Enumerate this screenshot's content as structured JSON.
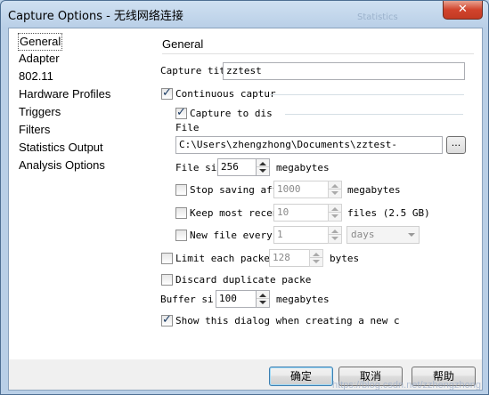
{
  "window": {
    "title": "Capture Options - 无线网络连接",
    "title_ghost": "Statistics",
    "close_glyph": "✕"
  },
  "sidebar": {
    "items": [
      {
        "label": "General",
        "selected": true
      },
      {
        "label": "Adapter"
      },
      {
        "label": "802.11"
      },
      {
        "label": "Hardware Profiles"
      },
      {
        "label": "Triggers"
      },
      {
        "label": "Filters"
      },
      {
        "label": "Statistics Output"
      },
      {
        "label": "Analysis Options"
      }
    ]
  },
  "general": {
    "heading": "General",
    "capture_title_label": "Capture tit",
    "capture_title_value": "zztest",
    "continuous_capture": {
      "label": "Continuous captur",
      "checked": true
    },
    "capture_to_disk": {
      "label": "Capture to dis",
      "checked": true
    },
    "file_label": "File",
    "file_value": "C:\\Users\\zhengzhong\\Documents\\zztest-",
    "browse_label": "...",
    "file_size_label": "File si",
    "file_size_value": "256",
    "file_size_unit": "megabytes",
    "stop_saving": {
      "label": "Stop saving aft",
      "checked": false,
      "value": "1000",
      "unit": "megabytes"
    },
    "keep_recent": {
      "label": "Keep most recen",
      "checked": false,
      "value": "10",
      "unit": "files (2.5 GB)"
    },
    "new_file_every": {
      "label": "New file every",
      "checked": false,
      "value": "1",
      "unit": "days"
    },
    "limit_packet": {
      "label": "Limit each packet",
      "checked": false,
      "value": "128",
      "unit": "bytes"
    },
    "discard_duplicate": {
      "label": "Discard duplicate packe",
      "checked": false
    },
    "buffer_size_label": "Buffer si",
    "buffer_size_value": "100",
    "buffer_size_unit": "megabytes",
    "show_dialog": {
      "label": "Show this dialog when creating a new c",
      "checked": true
    }
  },
  "buttons": {
    "ok": "确定",
    "cancel": "取消",
    "help": "帮助"
  },
  "watermark": "https://blog.csdn.net/zzhengzhong"
}
